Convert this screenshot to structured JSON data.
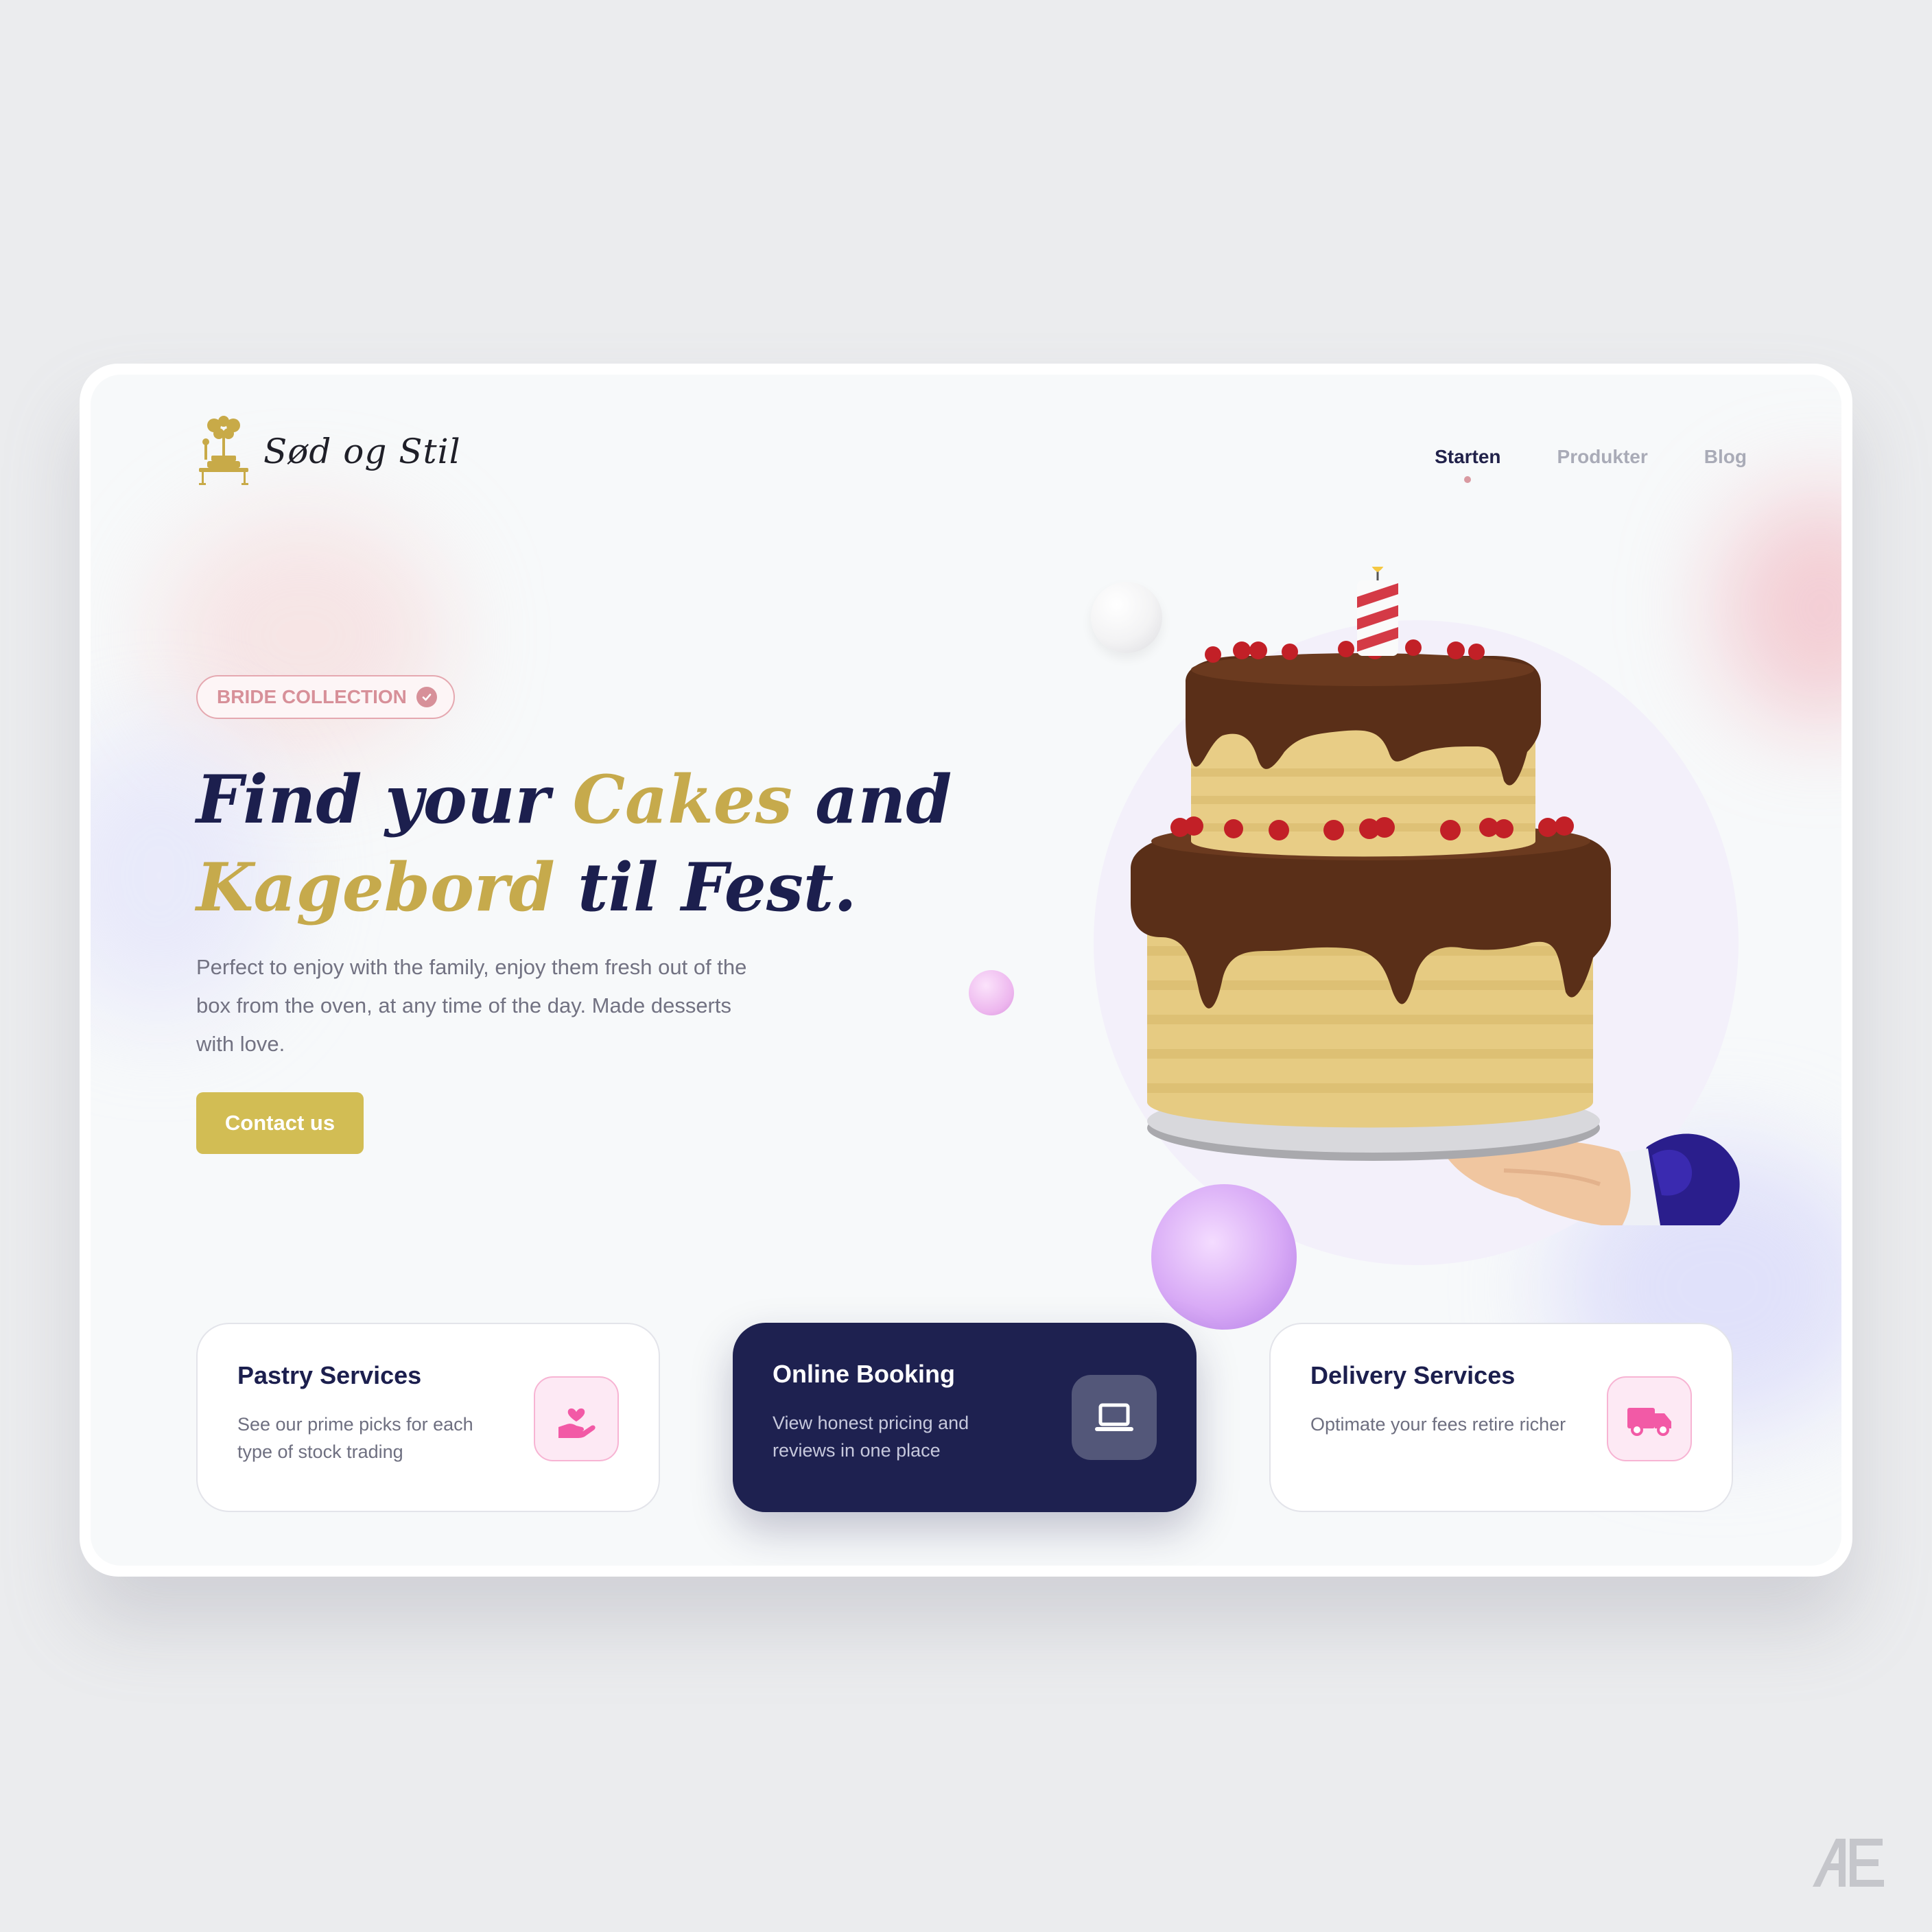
{
  "brand": {
    "name": "Sød og Stil"
  },
  "nav": {
    "items": [
      {
        "label": "Starten",
        "active": true
      },
      {
        "label": "Produkter",
        "active": false
      },
      {
        "label": "Blog",
        "active": false
      }
    ]
  },
  "hero": {
    "badge": "BRIDE COLLECTION",
    "headline": {
      "part1": "Find your ",
      "gold1": "Cakes",
      "part2": " and",
      "gold2": "Kagebord",
      "part3": " til Fest."
    },
    "description": "Perfect to enjoy with the family, enjoy them fresh out of the box from the oven, at any time of the day. Made desserts with love.",
    "cta": "Contact us"
  },
  "services": [
    {
      "title": "Pastry Services",
      "desc": "See our prime picks for each type of stock trading",
      "icon": "hand-heart-icon"
    },
    {
      "title": "Online Booking",
      "desc": "View honest pricing and reviews in one place",
      "icon": "laptop-icon"
    },
    {
      "title": "Delivery Services",
      "desc": "Optimate your fees retire richer",
      "icon": "truck-icon"
    }
  ],
  "colors": {
    "navy": "#1e2150",
    "gold": "#c6aa4c",
    "button": "#d2bd54",
    "pink": "#d79099",
    "background": "#ebecee"
  }
}
